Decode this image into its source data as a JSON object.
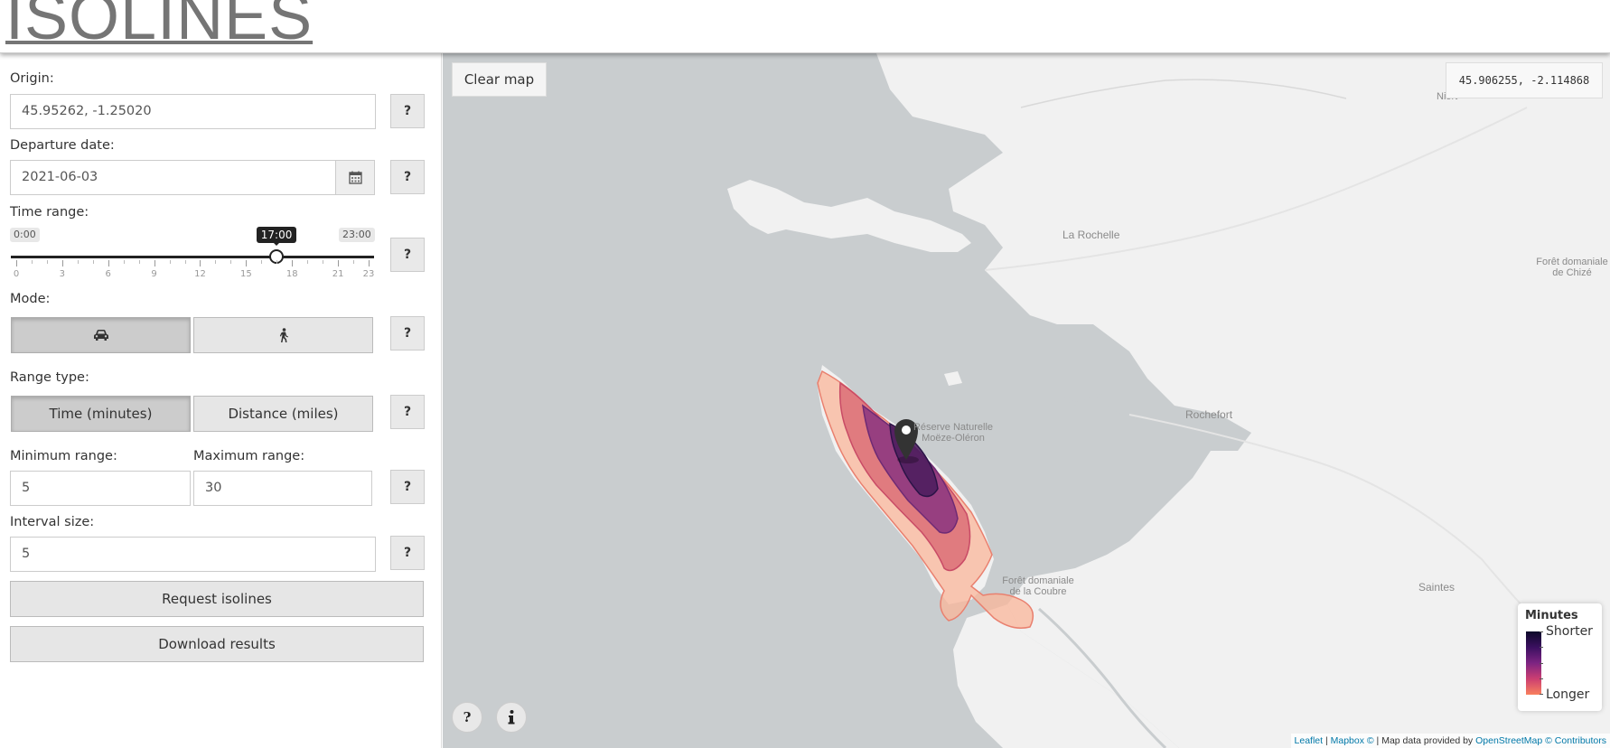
{
  "app": {
    "title": "ISOLINES"
  },
  "sidebar": {
    "origin": {
      "label": "Origin:",
      "value": "45.95262, -1.25020"
    },
    "departure": {
      "label": "Departure date:",
      "value": "2021-06-03"
    },
    "time_range": {
      "label": "Time range:",
      "min_label": "0:00",
      "max_label": "23:00",
      "current": "17:00",
      "min": 0,
      "max": 23,
      "value": 17,
      "ticks": [
        "0",
        "3",
        "6",
        "9",
        "12",
        "15",
        "18",
        "21",
        "23"
      ]
    },
    "mode": {
      "label": "Mode:",
      "options": [
        "car",
        "walk"
      ],
      "selected": "car"
    },
    "range_type": {
      "label": "Range type:",
      "options": [
        "Time (minutes)",
        "Distance (miles)"
      ],
      "selected": "Time (minutes)"
    },
    "min_range": {
      "label": "Minimum range:",
      "value": "5"
    },
    "max_range": {
      "label": "Maximum range:",
      "value": "30"
    },
    "interval": {
      "label": "Interval size:",
      "value": "5"
    },
    "help_label": "?",
    "request_button": "Request isolines",
    "download_button": "Download results"
  },
  "map": {
    "clear_button": "Clear map",
    "coordinates": "45.906255, -2.114868",
    "help_button": "?",
    "info_icon": "info-icon",
    "places": {
      "niort": "Niort",
      "la_rochelle": "La Rochelle",
      "chize_1": "Forêt domaniale",
      "chize_2": "de Chizé",
      "reserve_1": "Réserve Naturelle",
      "reserve_2": "Moëze-Oléron",
      "rochefort": "Rochefort",
      "coubre_1": "Forêt domaniale",
      "coubre_2": "de la Coubre",
      "saintes": "Saintes"
    },
    "legend": {
      "title": "Minutes",
      "top": "Shorter",
      "bottom": "Longer"
    },
    "attribution": {
      "leaflet": "Leaflet",
      "sep1": " | ",
      "mapbox": "Mapbox ©",
      "text": " | Map data provided by ",
      "osm": "OpenStreetMap © Contributors"
    },
    "colors": {
      "water": "#c9cdcf",
      "land": "#f1f1f1",
      "iso_far": "#f9b59a",
      "iso_mid": "#d96873",
      "iso_near": "#6e2a74",
      "iso_core": "#2b1447"
    }
  }
}
